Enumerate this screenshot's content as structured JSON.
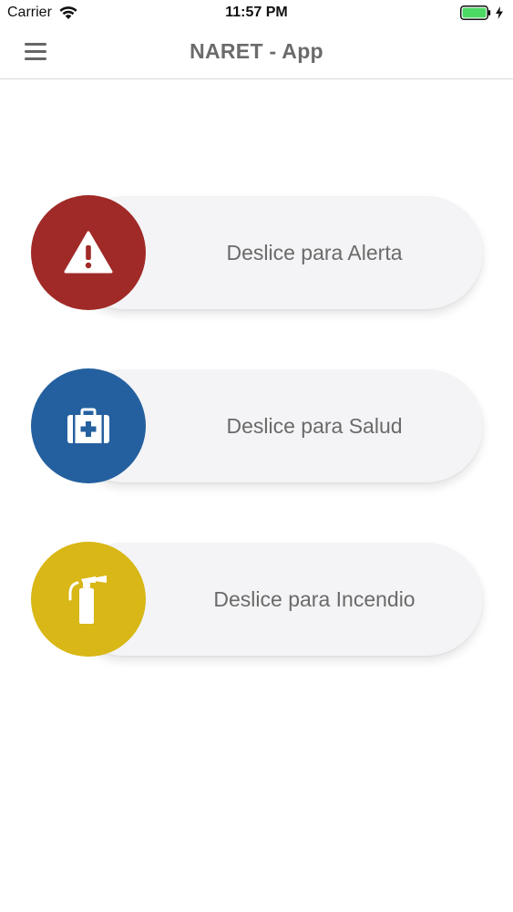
{
  "status_bar": {
    "carrier": "Carrier",
    "time": "11:57 PM",
    "icons": [
      "wifi-icon",
      "battery-icon",
      "charging-bolt-icon"
    ]
  },
  "nav": {
    "title": "NARET - App",
    "menu_icon": "hamburger-menu-icon"
  },
  "sliders": [
    {
      "label": "Deslice para Alerta",
      "icon": "warning-triangle-icon",
      "color": "#a02a27"
    },
    {
      "label": "Deslice para Salud",
      "icon": "first-aid-kit-icon",
      "color": "#24609f"
    },
    {
      "label": "Deslice para Incendio",
      "icon": "fire-extinguisher-icon",
      "color": "#d8b716"
    }
  ],
  "colors": {
    "battery": "#4cd964",
    "track": "#f4f4f6",
    "text": "#6a6a6a"
  }
}
